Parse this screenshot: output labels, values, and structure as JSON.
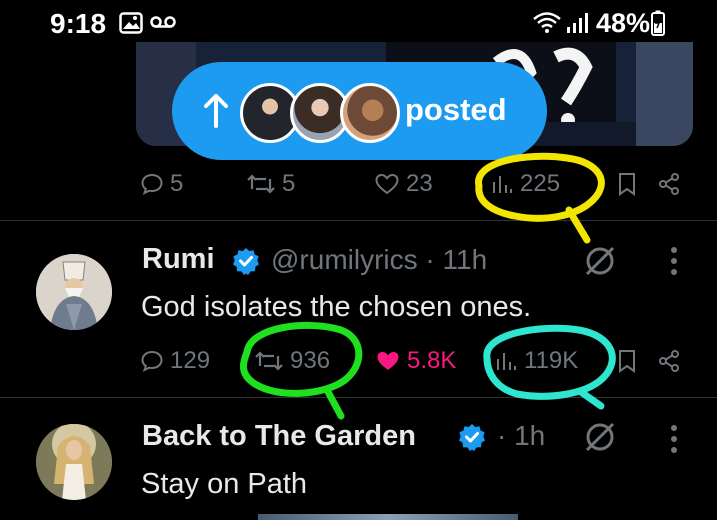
{
  "status_bar": {
    "time": "9:18",
    "battery": "48%",
    "icons": [
      "image-icon",
      "voicemail-icon",
      "wifi-icon",
      "signal-icon",
      "battery-icon"
    ]
  },
  "posted_pill": {
    "label": "posted",
    "icon": "arrow-up-icon"
  },
  "first_tweet_actions": {
    "replies": "5",
    "reposts": "5",
    "likes": "23",
    "views": "225"
  },
  "tweets": [
    {
      "name": "Rumi",
      "handle": "@rumilyrics · 11h",
      "text": "God isolates the chosen ones.",
      "actions": {
        "replies": "129",
        "reposts": "936",
        "likes": "5.8K",
        "views": "119K"
      }
    },
    {
      "name": "Back to The Garden",
      "handle": "· 1h",
      "text": "Stay on Path"
    }
  ],
  "colors": {
    "accent": "#1d9bf0",
    "like": "#f91880",
    "annotation_yellow": "#f2e600",
    "annotation_green": "#1ee01e",
    "annotation_cyan": "#2ee6cf"
  }
}
